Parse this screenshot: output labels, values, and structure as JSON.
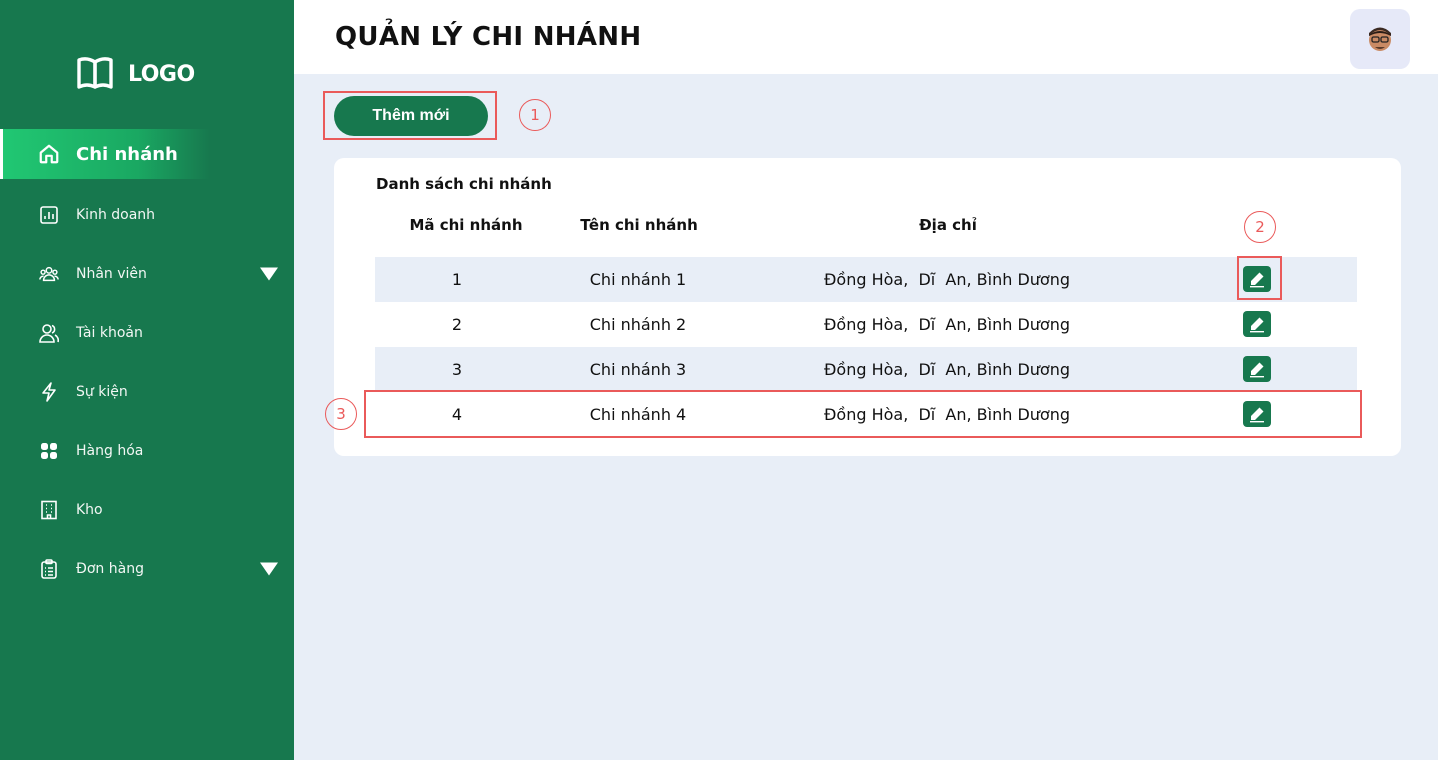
{
  "app": {
    "logo_text": "LOGO",
    "page_title": "QUẢN LÝ CHI NHÁNH"
  },
  "sidebar": {
    "items": [
      {
        "label": "Chi nhánh",
        "icon": "home-icon",
        "active": true
      },
      {
        "label": "Kinh doanh",
        "icon": "chart-icon"
      },
      {
        "label": "Nhân viên",
        "icon": "users-icon",
        "expandable": true
      },
      {
        "label": "Tài khoản",
        "icon": "user-account-icon"
      },
      {
        "label": "Sự kiện",
        "icon": "lightning-icon"
      },
      {
        "label": "Hàng hóa",
        "icon": "grid-icon"
      },
      {
        "label": "Kho",
        "icon": "building-icon"
      },
      {
        "label": "Đơn hàng",
        "icon": "clipboard-icon",
        "expandable": true
      }
    ]
  },
  "toolbar": {
    "add_label": "Thêm mới"
  },
  "annotations": {
    "a1": "1",
    "a2": "2",
    "a3": "3"
  },
  "table": {
    "title": "Danh sách chi nhánh",
    "headers": {
      "code": "Mã chi nhánh",
      "name": "Tên chi nhánh",
      "address": "Địa chỉ"
    },
    "rows": [
      {
        "code": "1",
        "name": "Chi nhánh 1",
        "address": "Đồng Hòa,  Dĩ  An, Bình Dương"
      },
      {
        "code": "2",
        "name": "Chi nhánh 2",
        "address": "Đồng Hòa,  Dĩ  An, Bình Dương"
      },
      {
        "code": "3",
        "name": "Chi nhánh 3",
        "address": "Đồng Hòa,  Dĩ  An, Bình Dương"
      },
      {
        "code": "4",
        "name": "Chi nhánh 4",
        "address": "Đồng Hòa,  Dĩ  An, Bình Dương"
      }
    ]
  },
  "colors": {
    "brand": "#17784e",
    "accent": "#21c873",
    "annotation": "#ea5a5a",
    "background": "#e8eef7"
  }
}
